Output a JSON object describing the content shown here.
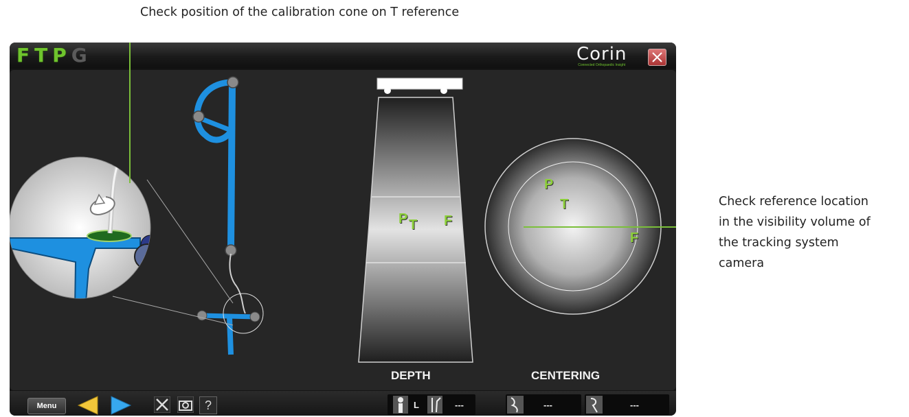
{
  "annotations": {
    "top": "Check position of the calibration cone on T reference",
    "right_lines": [
      "Check reference location",
      "in the visibility volume of",
      "the tracking system",
      "camera"
    ]
  },
  "titlebar": {
    "letters": [
      {
        "char": "F",
        "active": true
      },
      {
        "char": "T",
        "active": true
      },
      {
        "char": "P",
        "active": true
      },
      {
        "char": "G",
        "active": false
      }
    ],
    "brand": "Corin",
    "brand_tagline": "Connected Orthopaedic Insight",
    "close_icon": "close-x-icon"
  },
  "depth_view": {
    "label": "DEPTH",
    "markers": [
      "P",
      "T",
      "F"
    ]
  },
  "centering_view": {
    "label": "CENTERING",
    "markers": [
      "P",
      "T",
      "F"
    ]
  },
  "toolbar": {
    "menu_label": "Menu",
    "back_icon": "yellow-left-arrow-icon",
    "forward_icon": "blue-right-arrow-icon",
    "tools_icon": "tools-icon",
    "camera_icon": "camera-icon",
    "help_label": "?",
    "side_label": "L",
    "value_1": "---",
    "value_2": "---",
    "value_3": "---"
  },
  "colors": {
    "accent_green": "#6fc42d",
    "instrument_blue": "#1e90e0",
    "background_dark": "#262626"
  }
}
